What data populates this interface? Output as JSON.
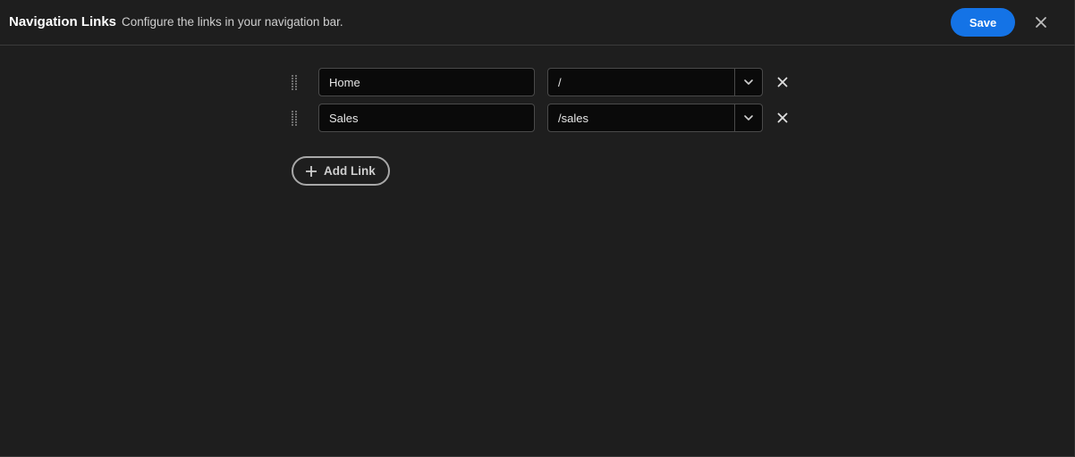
{
  "header": {
    "title": "Navigation Links",
    "subtitle": "Configure the links in your navigation bar.",
    "save_label": "Save",
    "close_icon": "close-icon"
  },
  "links": [
    {
      "label": "Home",
      "path": "/"
    },
    {
      "label": "Sales",
      "path": "/sales"
    }
  ],
  "add_link_label": "Add Link",
  "colors": {
    "background": "#1e1e1e",
    "accent": "#1473e6",
    "input_bg": "#0a0a0a"
  }
}
